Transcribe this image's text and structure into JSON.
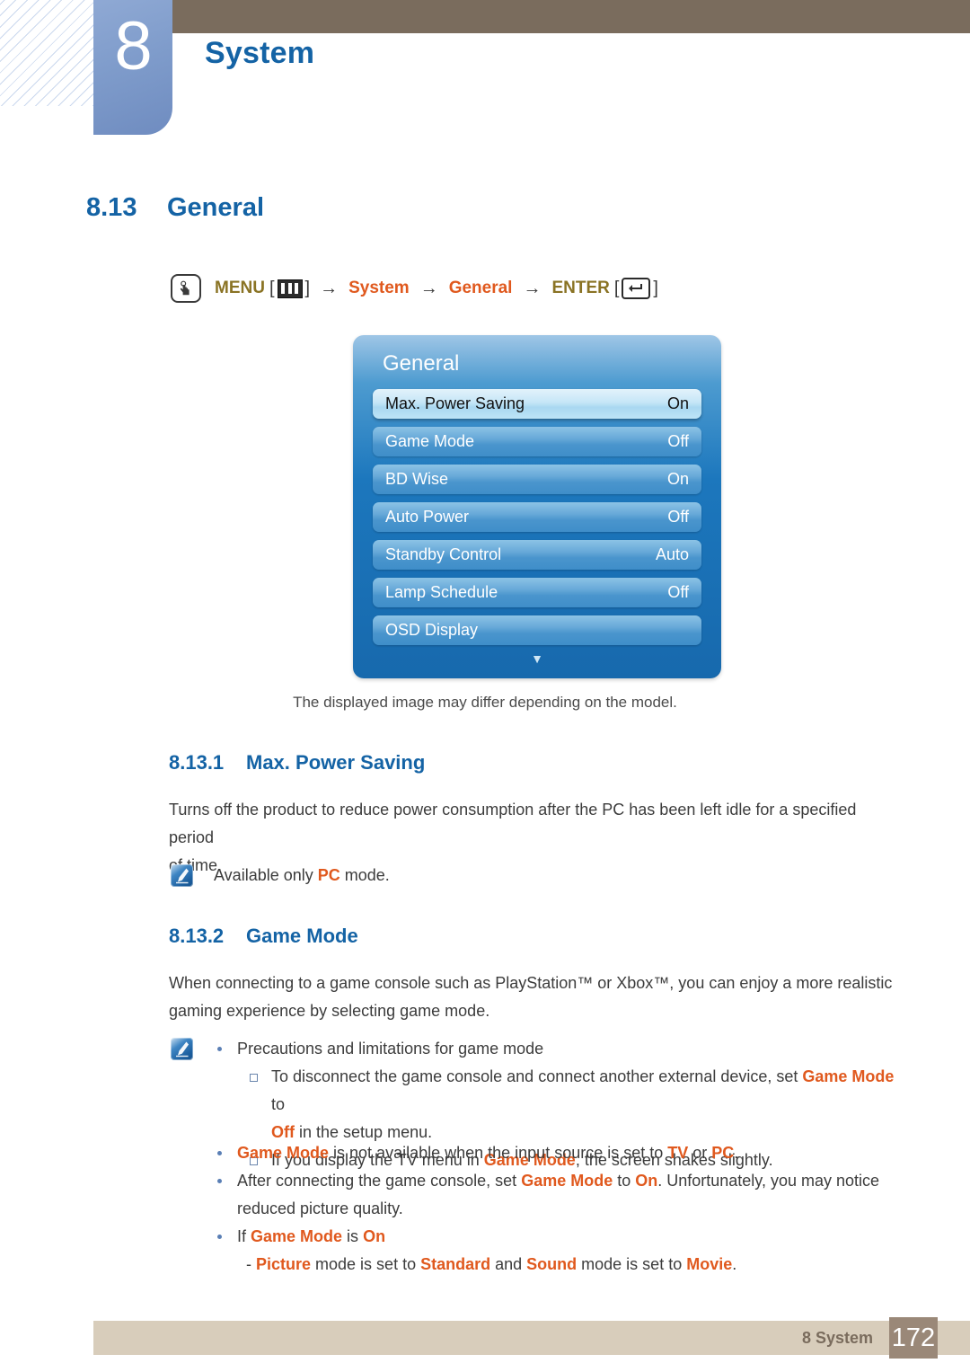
{
  "header": {
    "chapter_number": "8",
    "chapter_title": "System",
    "brand_blue": "#1463a5",
    "bar_brown": "#7a6c5d"
  },
  "section": {
    "number": "8.13",
    "title": "General"
  },
  "menu_path": {
    "hand_icon": "hand-press-icon",
    "menu_label": "MENU",
    "menu_key_icon": "menu-bars-icon",
    "arrow": "→",
    "bracket_open": "[",
    "bracket_close": "]",
    "step_system": "System",
    "step_general": "General",
    "enter_label": "ENTER",
    "enter_key_icon": "enter-key-icon",
    "olive": "#8a7324",
    "orange": "#e0591e"
  },
  "osd": {
    "title": "General",
    "scroll_indicator": "▼",
    "rows": [
      {
        "label": "Max. Power Saving",
        "value": "On",
        "selected": true
      },
      {
        "label": "Game Mode",
        "value": "Off",
        "selected": false
      },
      {
        "label": "BD Wise",
        "value": "On",
        "selected": false
      },
      {
        "label": "Auto Power",
        "value": "Off",
        "selected": false
      },
      {
        "label": "Standby Control",
        "value": "Auto",
        "selected": false
      },
      {
        "label": "Lamp Schedule",
        "value": "Off",
        "selected": false
      },
      {
        "label": "OSD Display",
        "value": "",
        "selected": false
      }
    ]
  },
  "caption": "The displayed image may differ depending on the model.",
  "sub_sections": {
    "max_power_saving": {
      "number": "8.13.1",
      "title": "Max. Power Saving",
      "body_line1": "Turns off the product to reduce power consumption after the PC has been left idle for a specified period",
      "body_line2": "of time.",
      "note_icon": "note-pencil-icon",
      "note_prefix": "Available only ",
      "note_highlight": "PC",
      "note_suffix": " mode."
    },
    "game_mode": {
      "number": "8.13.2",
      "title": "Game Mode",
      "body_line1": "When connecting to a game console such as PlayStation™ or Xbox™, you can enjoy a more realistic",
      "body_line2": "gaming experience by selecting game mode.",
      "note_icon": "note-pencil-icon",
      "bullet1": "Precautions and limitations for game mode",
      "sub1_a": "To disconnect the game console and connect another external device, set ",
      "sub1_b": "Game Mode",
      "sub1_c": " to",
      "sub1_d": "Off",
      "sub1_e": " in the setup menu.",
      "sub2_a": "If you display the TV menu in ",
      "sub2_b": "Game Mode",
      "sub2_c": ", the screen shakes slightly.",
      "bullet2_a": "Game Mode",
      "bullet2_b": " is not available when the input source is set to ",
      "bullet2_c": "TV",
      "bullet2_d": " or ",
      "bullet2_e": "PC",
      "bullet2_f": ".",
      "bullet3_a": "After connecting the game console, set ",
      "bullet3_b": "Game Mode",
      "bullet3_c": " to ",
      "bullet3_d": "On",
      "bullet3_e": ". Unfortunately, you may notice",
      "bullet3_f": "reduced picture quality.",
      "bullet4_a": "If ",
      "bullet4_b": "Game Mode",
      "bullet4_c": " is ",
      "bullet4_d": "On",
      "bullet4_dash_a": "- ",
      "bullet4_dash_b": "Picture",
      "bullet4_dash_c": " mode is set to ",
      "bullet4_dash_d": "Standard",
      "bullet4_dash_e": " and ",
      "bullet4_dash_f": "Sound",
      "bullet4_dash_g": " mode is set to ",
      "bullet4_dash_h": "Movie",
      "bullet4_dash_i": "."
    }
  },
  "footer": {
    "label": "8 System",
    "page_number": "172"
  }
}
